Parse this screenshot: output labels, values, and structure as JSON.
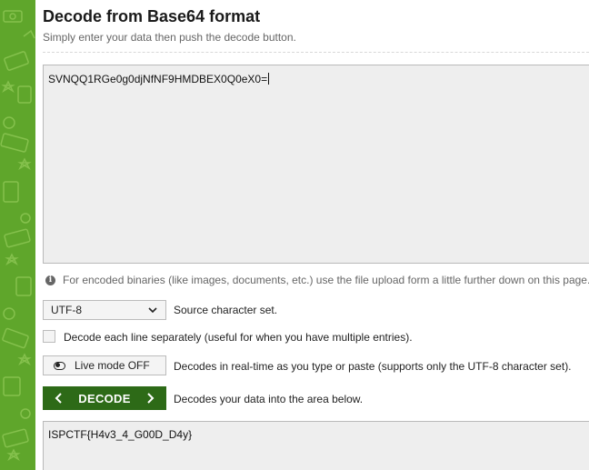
{
  "page": {
    "title": "Decode from Base64 format",
    "subtitle": "Simply enter your data then push the decode button."
  },
  "input": {
    "value": "SVNQQ1RGe0g0djNfNF9HMDBEX0Q0eX0="
  },
  "info": {
    "icon": "info-icon",
    "text": "For encoded binaries (like images, documents, etc.) use the file upload form a little further down on this page."
  },
  "charset": {
    "selected": "UTF-8",
    "label": "Source character set."
  },
  "each_line": {
    "checked": false,
    "label": "Decode each line separately (useful for when you have multiple entries)."
  },
  "live_mode": {
    "button_label": "Live mode OFF",
    "description": "Decodes in real-time as you type or paste (supports only the UTF-8 character set)."
  },
  "decode": {
    "button_label": "DECODE",
    "description": "Decodes your data into the area below."
  },
  "output": {
    "value": "ISPCTF{H4v3_4_G00D_D4y}"
  },
  "colors": {
    "sidebar_green": "#5fa62b",
    "decode_button": "#2d6a17"
  }
}
